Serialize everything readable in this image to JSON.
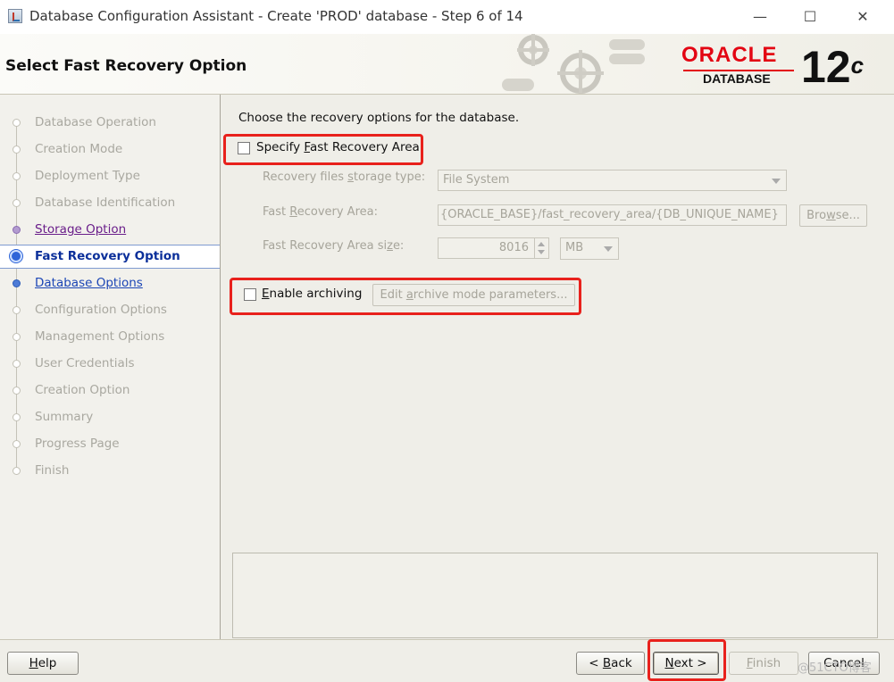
{
  "window": {
    "title": "Database Configuration Assistant - Create 'PROD' database - Step 6 of 14",
    "minimize_symbol": "—",
    "maximize_symbol": "☐",
    "close_symbol": "✕"
  },
  "header": {
    "step_title": "Select Fast Recovery Option",
    "brand": "ORACLE",
    "brand_sub": "DATABASE",
    "version_number": "12",
    "version_suffix": "c"
  },
  "nav": {
    "items": [
      {
        "label": "Database Operation",
        "state": "disabled"
      },
      {
        "label": "Creation Mode",
        "state": "disabled"
      },
      {
        "label": "Deployment Type",
        "state": "disabled"
      },
      {
        "label": "Database Identification",
        "state": "disabled"
      },
      {
        "label": "Storage Option",
        "state": "visited"
      },
      {
        "label": "Fast Recovery Option",
        "state": "current"
      },
      {
        "label": "Database Options",
        "state": "link"
      },
      {
        "label": "Configuration Options",
        "state": "disabled"
      },
      {
        "label": "Management Options",
        "state": "disabled"
      },
      {
        "label": "User Credentials",
        "state": "disabled"
      },
      {
        "label": "Creation Option",
        "state": "disabled"
      },
      {
        "label": "Summary",
        "state": "disabled"
      },
      {
        "label": "Progress Page",
        "state": "disabled"
      },
      {
        "label": "Finish",
        "state": "disabled"
      }
    ]
  },
  "content": {
    "intro": "Choose the recovery options for the database.",
    "specify_fra": {
      "pre": "Specify ",
      "mnemonic": "F",
      "post": "ast Recovery Area",
      "checked": false
    },
    "storage_type": {
      "label_pre": "Recovery files ",
      "label_mnemonic": "s",
      "label_post": "torage type:",
      "value": "File System"
    },
    "fra_location": {
      "label_pre": "Fast ",
      "label_mnemonic": "R",
      "label_post": "ecovery Area:",
      "value": "{ORACLE_BASE}/fast_recovery_area/{DB_UNIQUE_NAME}",
      "browse_pre": "Bro",
      "browse_mnemonic": "w",
      "browse_post": "se..."
    },
    "fra_size": {
      "label_pre": "Fast Recovery Area si",
      "label_mnemonic": "z",
      "label_post": "e:",
      "value": "8016",
      "unit": "MB"
    },
    "archiving": {
      "mnemonic": "E",
      "post": "nable archiving",
      "checked": false,
      "edit_pre": "Edit ",
      "edit_mnemonic": "a",
      "edit_post": "rchive mode parameters..."
    }
  },
  "footer": {
    "help": {
      "mnemonic": "H",
      "post": "elp"
    },
    "back": {
      "pre": "< ",
      "mnemonic": "B",
      "post": "ack"
    },
    "next": {
      "mnemonic": "N",
      "post": "ext >"
    },
    "finish": {
      "mnemonic": "F",
      "post": "inish"
    },
    "cancel": "Cancel",
    "watermark": "@51CTO博客"
  },
  "colors": {
    "highlight": "#e8211c",
    "oracle_red": "#e30613",
    "current_step": "#0b2f9a"
  }
}
